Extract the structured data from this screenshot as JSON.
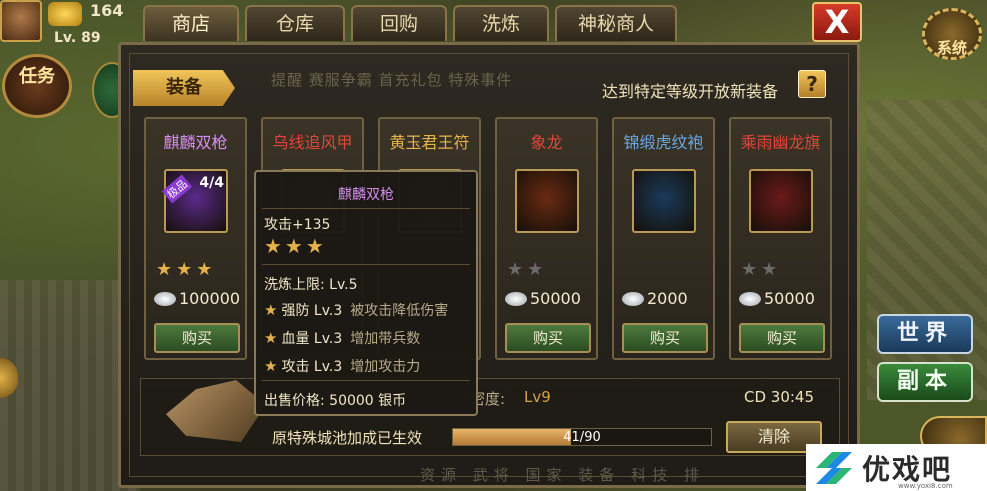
{
  "player": {
    "gold": "164",
    "level": "Lv. 89"
  },
  "hud": {
    "task_label": "任务",
    "system_label": "系统",
    "world_label": "世界",
    "dungeon_label": "副本"
  },
  "tabs": [
    {
      "label": "商店",
      "active": true
    },
    {
      "label": "仓库",
      "active": false
    },
    {
      "label": "回购",
      "active": false
    },
    {
      "label": "洗炼",
      "active": false
    },
    {
      "label": "神秘商人",
      "active": false
    }
  ],
  "close_label": "X",
  "shop": {
    "category_label": "装备",
    "unlock_hint": "达到特定等级开放新装备",
    "help_label": "?",
    "background_hint": "提醒 赛服争霸 首充礼包 特殊事件",
    "items": [
      {
        "name": "麒麟双枪",
        "name_color": "#d58ff0",
        "badge": "极品",
        "count": "4/4",
        "stars": "★★★",
        "star_color": "#e3b24a",
        "price": "100000",
        "buy_label": "购买",
        "icon": "twin-spear-icon",
        "icon_bg": "#5a2a8a"
      },
      {
        "name": "乌线追风甲",
        "name_color": "#e0453a",
        "stars": "",
        "star_color": "#e3b24a",
        "price": "",
        "buy_label": "",
        "icon": "armor-icon",
        "icon_bg": "#5a2a1a"
      },
      {
        "name": "黄玉君王符",
        "name_color": "#e6b44a",
        "stars": "",
        "star_color": "#e3b24a",
        "price": "",
        "buy_label": "",
        "icon": "talisman-icon",
        "icon_bg": "#5a4a1a"
      },
      {
        "name": "象龙",
        "name_color": "#e0453a",
        "stars": "★★",
        "star_color": "#6a6a6a",
        "price": "50000",
        "buy_label": "购买",
        "icon": "horse-icon",
        "icon_bg": "#6a2a12"
      },
      {
        "name": "锦缎虎纹袍",
        "name_color": "#6aa8e6",
        "stars": "",
        "star_color": "#6a6a6a",
        "price": "2000",
        "buy_label": "购买",
        "icon": "robe-icon",
        "icon_bg": "#1a3a5a"
      },
      {
        "name": "乘雨幽龙旗",
        "name_color": "#e0453a",
        "stars": "★★",
        "star_color": "#6a6a6a",
        "price": "50000",
        "buy_label": "购买",
        "icon": "banner-icon",
        "icon_bg": "#6a1a1a"
      }
    ]
  },
  "tooltip": {
    "title": "麒麟双枪",
    "attack": "攻击+135",
    "stars": "★★★",
    "refine_limit": "洗炼上限: Lv.5",
    "effects": [
      {
        "name": "强防 Lv.3",
        "desc": "被攻击降低伤害"
      },
      {
        "name": "血量 Lv.3",
        "desc": "增加带兵数"
      },
      {
        "name": "攻击 Lv.3",
        "desc": "增加攻击力"
      }
    ],
    "sell_price": "出售价格: 50000 银币"
  },
  "bottom": {
    "level_label": "密度:",
    "level_value": "Lv9",
    "cd": "CD 30:45",
    "city_bonus": "原特殊城池加成已生效",
    "progress_text": "41/90",
    "progress_fraction": 0.4556,
    "clear_label": "清除",
    "faded_nav": "资源 武将 国家 装备 科技 排"
  },
  "watermark": {
    "text": "优戏吧",
    "url": "www.yoxi8.com"
  }
}
